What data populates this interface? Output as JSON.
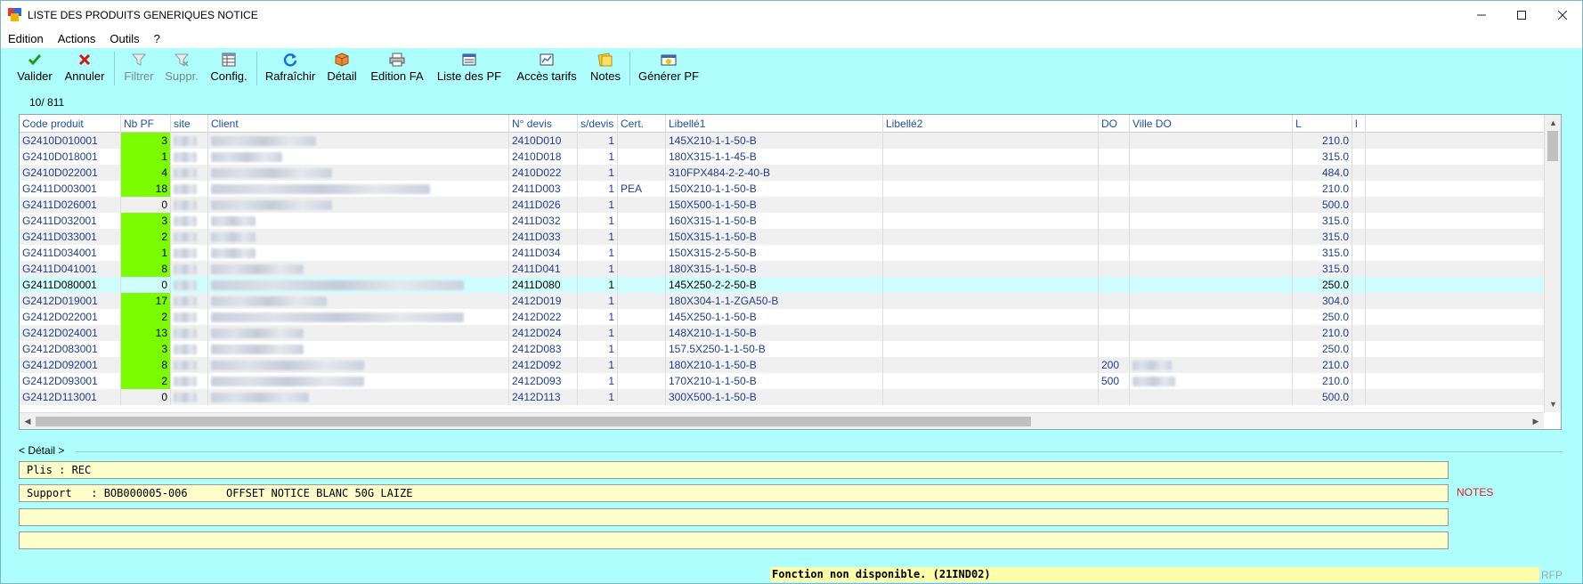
{
  "window": {
    "title": "LISTE DES PRODUITS GENERIQUES NOTICE"
  },
  "menu": [
    "Edition",
    "Actions",
    "Outils",
    "?"
  ],
  "toolbar": {
    "valider": "Valider",
    "annuler": "Annuler",
    "filtrer": "Filtrer",
    "suppr": "Suppr.",
    "config": "Config.",
    "rafraichir": "Rafraîchir",
    "detail": "Détail",
    "edition_fa": "Edition FA",
    "liste_pf": "Liste des PF",
    "acces_tarifs": "Accès tarifs",
    "notes": "Notes",
    "generer_pf": "Générer PF"
  },
  "record_count": "10/  811",
  "grid": {
    "columns": [
      "Code produit",
      "Nb PF",
      "site",
      "Client",
      "N° devis",
      "s/devis",
      "Cert.",
      "Libellé1",
      "Libellé2",
      "DO",
      "Ville DO",
      "L",
      "l"
    ],
    "rows": [
      {
        "code": "G2410D010001",
        "nbpf": "3",
        "devis": "2410D010",
        "sdevis": "1",
        "cert": "",
        "lib1": "145X210-1-1-50-B",
        "do": "",
        "l": "210.0"
      },
      {
        "code": "G2410D018001",
        "nbpf": "1",
        "devis": "2410D018",
        "sdevis": "1",
        "cert": "",
        "lib1": "180X315-1-1-45-B",
        "do": "",
        "l": "315.0"
      },
      {
        "code": "G2410D022001",
        "nbpf": "4",
        "devis": "2410D022",
        "sdevis": "1",
        "cert": "",
        "lib1": "310FPX484-2-2-40-B",
        "do": "",
        "l": "484.0"
      },
      {
        "code": "G2411D003001",
        "nbpf": "18",
        "devis": "2411D003",
        "sdevis": "1",
        "cert": "PEA",
        "lib1": "150X210-1-1-50-B",
        "do": "",
        "l": "210.0"
      },
      {
        "code": "G2411D026001",
        "nbpf": "0",
        "devis": "2411D026",
        "sdevis": "1",
        "cert": "",
        "lib1": "150X500-1-1-50-B",
        "do": "",
        "l": "500.0"
      },
      {
        "code": "G2411D032001",
        "nbpf": "3",
        "devis": "2411D032",
        "sdevis": "1",
        "cert": "",
        "lib1": "160X315-1-1-50-B",
        "do": "",
        "l": "315.0"
      },
      {
        "code": "G2411D033001",
        "nbpf": "2",
        "devis": "2411D033",
        "sdevis": "1",
        "cert": "",
        "lib1": "150X315-1-1-50-B",
        "do": "",
        "l": "315.0"
      },
      {
        "code": "G2411D034001",
        "nbpf": "1",
        "devis": "2411D034",
        "sdevis": "1",
        "cert": "",
        "lib1": "150X315-2-5-50-B",
        "do": "",
        "l": "315.0"
      },
      {
        "code": "G2411D041001",
        "nbpf": "8",
        "devis": "2411D041",
        "sdevis": "1",
        "cert": "",
        "lib1": "180X315-1-1-50-B",
        "do": "",
        "l": "315.0"
      },
      {
        "code": "G2411D080001",
        "nbpf": "0",
        "devis": "2411D080",
        "sdevis": "1",
        "cert": "",
        "lib1": "145X250-2-2-50-B",
        "do": "",
        "l": "250.0"
      },
      {
        "code": "G2412D019001",
        "nbpf": "17",
        "devis": "2412D019",
        "sdevis": "1",
        "cert": "",
        "lib1": "180X304-1-1-ZGA50-B",
        "do": "",
        "l": "304.0"
      },
      {
        "code": "G2412D022001",
        "nbpf": "2",
        "devis": "2412D022",
        "sdevis": "1",
        "cert": "",
        "lib1": "145X250-1-1-50-B",
        "do": "",
        "l": "250.0"
      },
      {
        "code": "G2412D024001",
        "nbpf": "13",
        "devis": "2412D024",
        "sdevis": "1",
        "cert": "",
        "lib1": "148X210-1-1-50-B",
        "do": "",
        "l": "210.0"
      },
      {
        "code": "G2412D083001",
        "nbpf": "3",
        "devis": "2412D083",
        "sdevis": "1",
        "cert": "",
        "lib1": "157.5X250-1-1-50-B",
        "do": "",
        "l": "250.0"
      },
      {
        "code": "G2412D092001",
        "nbpf": "8",
        "devis": "2412D092",
        "sdevis": "1",
        "cert": "",
        "lib1": "180X210-1-1-50-B",
        "do": "200",
        "l": "210.0"
      },
      {
        "code": "G2412D093001",
        "nbpf": "2",
        "devis": "2412D093",
        "sdevis": "1",
        "cert": "",
        "lib1": "170X210-1-1-50-B",
        "do": "500",
        "l": "210.0"
      },
      {
        "code": "G2412D113001",
        "nbpf": "0",
        "devis": "2412D113",
        "sdevis": "1",
        "cert": "",
        "lib1": "300X500-1-1-50-B",
        "do": "",
        "l": "500.0"
      }
    ]
  },
  "detail": {
    "label": "< Détail >",
    "lines": [
      "Plis : REC",
      "Support   : BOB000005-006      OFFSET NOTICE BLANC 50G LAIZE",
      "",
      ""
    ],
    "notes": "NOTES"
  },
  "status": {
    "message": "Fonction non disponible. (21IND02)",
    "right": "RFP"
  },
  "colors": {
    "background": "#aefefe",
    "nbpf_green": "#7cfc00",
    "detail_bg": "#ffffcc",
    "notes_red": "#e0201a"
  }
}
